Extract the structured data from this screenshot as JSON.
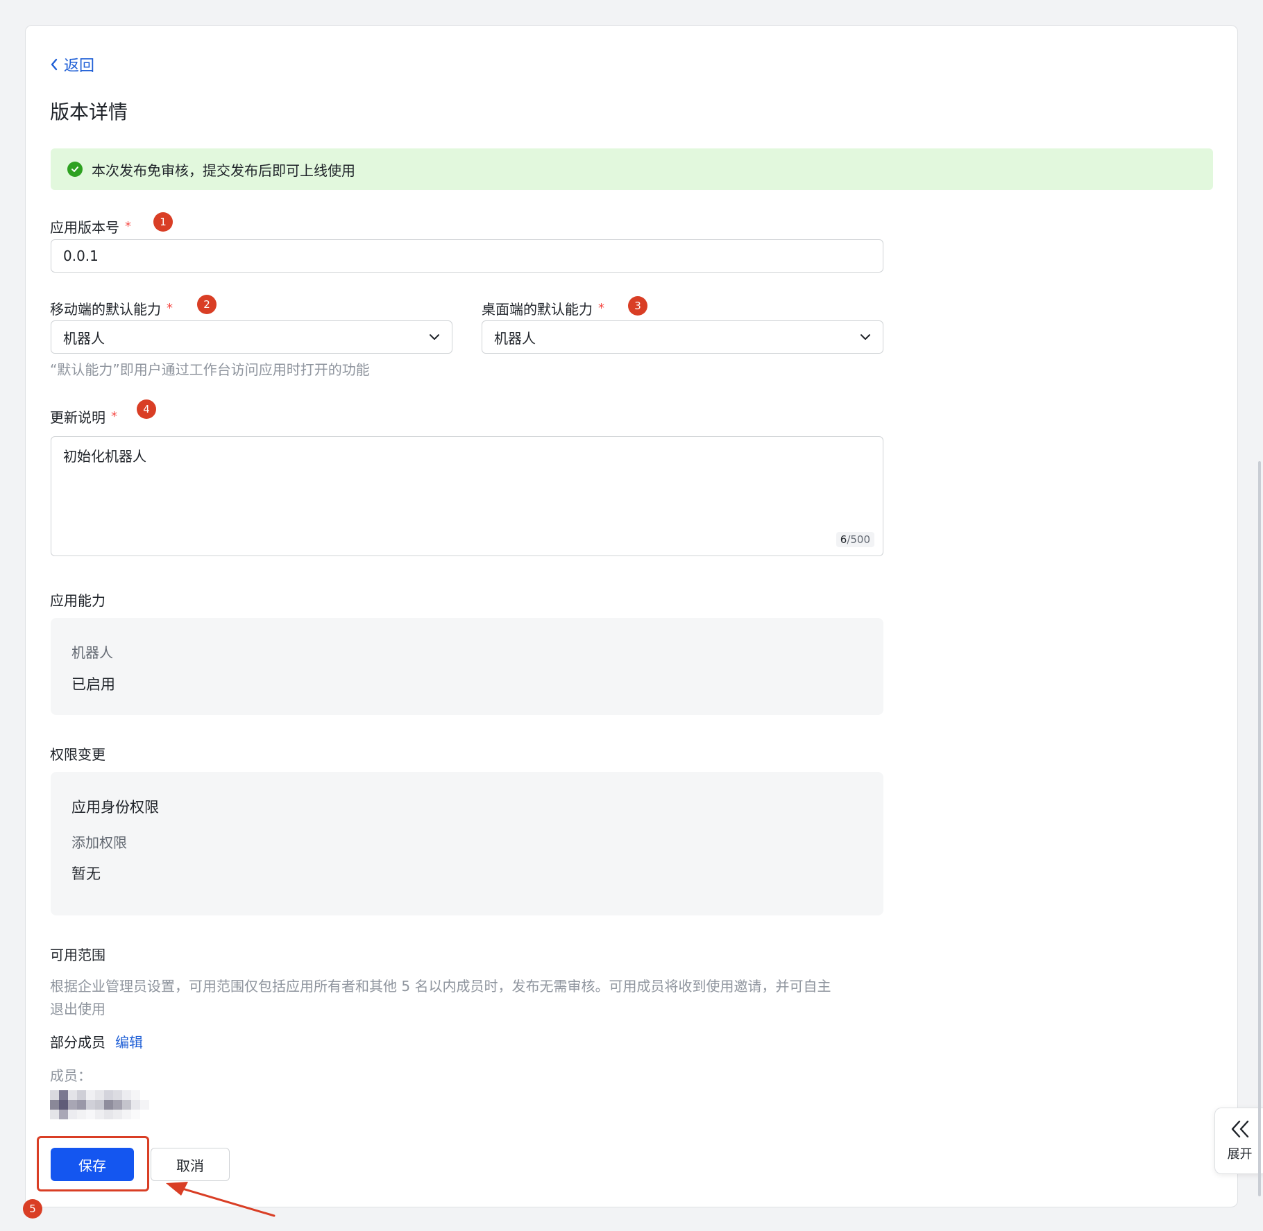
{
  "header": {
    "back_label": "返回",
    "title": "版本详情"
  },
  "alert": {
    "text": "本次发布免审核，提交发布后即可上线使用"
  },
  "version": {
    "label": "应用版本号",
    "required": "*",
    "value": "0.0.1",
    "badge": "1"
  },
  "mobile_default": {
    "label": "移动端的默认能力",
    "required": "*",
    "value": "机器人",
    "badge": "2"
  },
  "desktop_default": {
    "label": "桌面端的默认能力",
    "required": "*",
    "value": "机器人",
    "badge": "3"
  },
  "default_hint": "“默认能力”即用户通过工作台访问应用时打开的功能",
  "release_notes": {
    "label": "更新说明",
    "required": "*",
    "value": "初始化机器人",
    "count": "6",
    "max": "/500",
    "badge": "4"
  },
  "capabilities": {
    "title": "应用能力",
    "item_name": "机器人",
    "item_status": "已启用"
  },
  "permissions": {
    "title": "权限变更",
    "group": "应用身份权限",
    "added_label": "添加权限",
    "added_value": "暂无"
  },
  "scope": {
    "title": "可用范围",
    "desc_line1": "根据企业管理员设置，可用范围仅包括应用所有者和其他 5 名以内成员时，发布无需审核。可用成员将收到使用邀请，并可自主",
    "desc_line2": "退出使用",
    "mode": "部分成员",
    "edit_label": "编辑",
    "members_label": "成员："
  },
  "actions": {
    "save_label": "保存",
    "cancel_label": "取消",
    "badge": "5"
  },
  "expand": {
    "label": "展开"
  },
  "colors": {
    "primary": "#1456f0",
    "link": "#1f5fd6",
    "success_bg": "#e2f8dd",
    "success": "#2ea121",
    "annotation": "#d93e25",
    "required": "#f54a45"
  }
}
